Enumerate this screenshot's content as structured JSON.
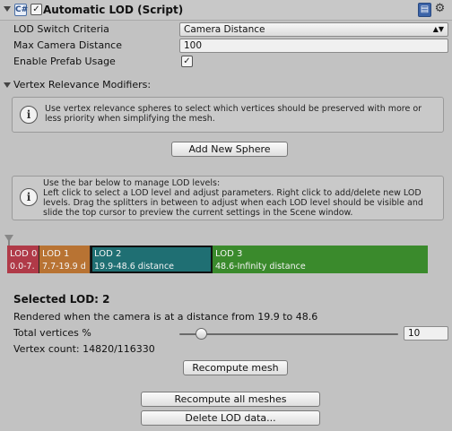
{
  "header": {
    "title": "Automatic LOD (Script)",
    "script_icon": "C#",
    "enabled_check": "✓",
    "icons": [
      "book-icon",
      "gear-icon"
    ]
  },
  "fields": {
    "lod_switch_label": "LOD Switch Criteria",
    "lod_switch_value": "Camera Distance",
    "max_cam_label": "Max Camera Distance",
    "max_cam_value": "100",
    "prefab_label": "Enable Prefab Usage",
    "prefab_check": "✓"
  },
  "vertex": {
    "foldout_label": "Vertex Relevance Modifiers:",
    "help_line1": "Use vertex relevance spheres to select which vertices should be preserved with more or",
    "help_line2": "less priority when simplifying the mesh.",
    "add_sphere": "Add New Sphere"
  },
  "lod_help": {
    "line1": "Use the bar below to manage LOD levels:",
    "line2": "Left click to select a LOD level and adjust parameters. Right click to add/delete new LOD",
    "line3": "levels. Drag the splitters in between to adjust when each LOD level should be visible and",
    "line4": "slide the top cursor to preview the current settings in the Scene window."
  },
  "lod_levels": [
    {
      "name": "LOD 0",
      "range": "0.0-7.",
      "color": "#b03a48"
    },
    {
      "name": "LOD 1",
      "range": "7.7-19.9 d",
      "color": "#b87333"
    },
    {
      "name": "LOD 2",
      "range": "19.9-48.6 distance",
      "color": "#1f6f73"
    },
    {
      "name": "LOD 3",
      "range": "48.6-Infinity distance",
      "color": "#3a8a2c"
    }
  ],
  "selected": {
    "title": "Selected LOD: 2",
    "rendered_text": "Rendered when the camera is at a distance from 19.9 to 48.6",
    "total_vertices_label": "Total vertices %",
    "total_vertices_value": "10",
    "total_vertices_fraction": 0.1,
    "vertex_count": "Vertex count: 14820/116330",
    "recompute_mesh": "Recompute mesh"
  },
  "actions": {
    "recompute_all": "Recompute all meshes",
    "delete_lod": "Delete LOD data..."
  }
}
